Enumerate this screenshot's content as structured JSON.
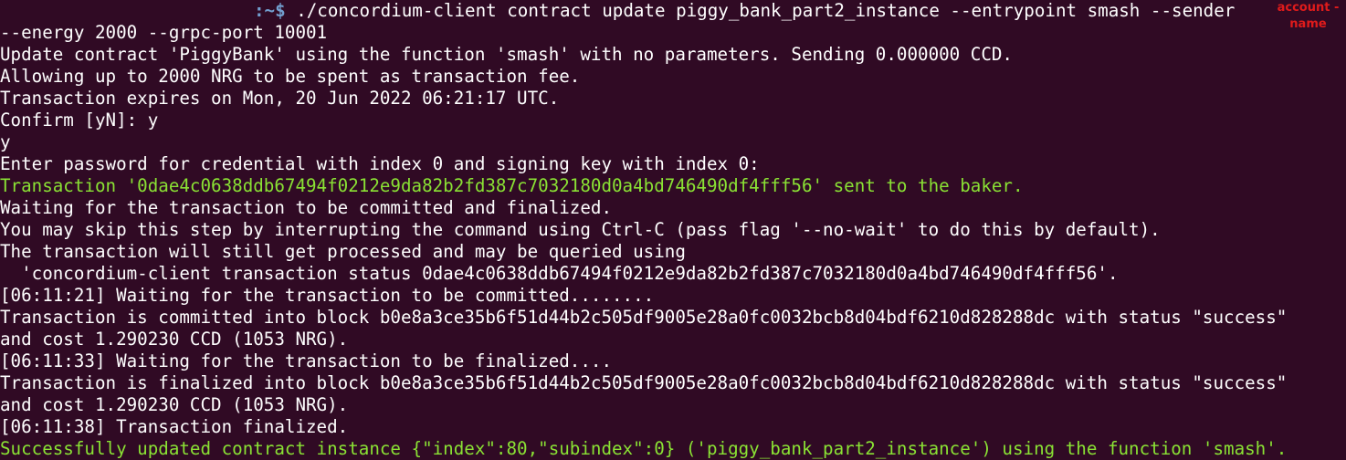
{
  "terminal": {
    "prompt_path": ":~$",
    "command": " ./concordium-client contract update piggy_bank_part2_instance --entrypoint smash --sender",
    "lines": [
      "--energy 2000 --grpc-port 10001",
      "Update contract 'PiggyBank' using the function 'smash' with no parameters. Sending 0.000000 CCD.",
      "Allowing up to 2000 NRG to be spent as transaction fee.",
      "Transaction expires on Mon, 20 Jun 2022 06:21:17 UTC.",
      "Confirm [yN]: y",
      "y",
      "Enter password for credential with index 0 and signing key with index 0:",
      "Transaction '0dae4c0638ddb67494f0212e9da82b2fd387c7032180d0a4bd746490df4fff56' sent to the baker.",
      "Waiting for the transaction to be committed and finalized.",
      "You may skip this step by interrupting the command using Ctrl-C (pass flag '--no-wait' to do this by default).",
      "The transaction will still get processed and may be queried using",
      "  'concordium-client transaction status 0dae4c0638ddb67494f0212e9da82b2fd387c7032180d0a4bd746490df4fff56'.",
      "[06:11:21] Waiting for the transaction to be committed........",
      "Transaction is committed into block b0e8a3ce35b6f51d44b2c505df9005e28a0fc0032bcb8d04bdf6210d828288dc with status \"success\"",
      "and cost 1.290230 CCD (1053 NRG).",
      "[06:11:33] Waiting for the transaction to be finalized....",
      "Transaction is finalized into block b0e8a3ce35b6f51d44b2c505df9005e28a0fc0032bcb8d04bdf6210d828288dc with status \"success\"",
      "and cost 1.290230 CCD (1053 NRG).",
      "[06:11:38] Transaction finalized.",
      "Successfully updated contract instance {\"index\":80,\"subindex\":0} ('piggy_bank_part2_instance') using the function 'smash'."
    ]
  },
  "overlay": {
    "line1": "account -",
    "line2": "name"
  },
  "colors": {
    "background": "#300a24",
    "text": "#ffffff",
    "success_green": "#8ae234",
    "prompt_blue": "#729fcf",
    "annotation_red": "#e01b1b"
  }
}
